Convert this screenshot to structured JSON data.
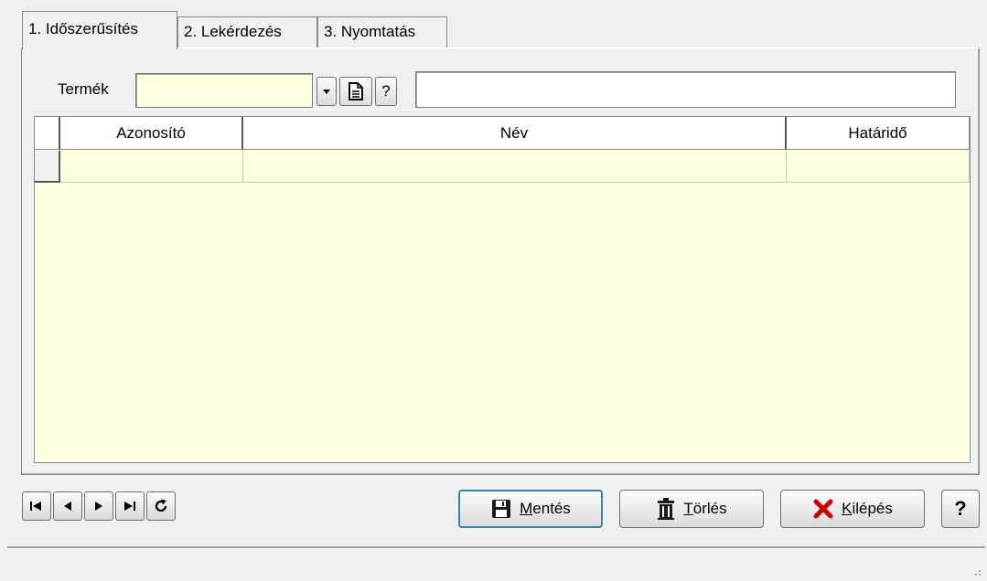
{
  "tabs": [
    {
      "label": "1. Időszerűsítés"
    },
    {
      "label": "2. Lekérdezés"
    },
    {
      "label": "3. Nyomtatás"
    }
  ],
  "filter": {
    "label": "Termék",
    "value": "",
    "description": ""
  },
  "grid": {
    "columns": [
      "Azonosító",
      "Név",
      "Határidő"
    ],
    "rows": [
      [
        "",
        "",
        ""
      ]
    ]
  },
  "buttons": {
    "save_u": "M",
    "save_rest": "entés",
    "delete_u": "T",
    "delete_rest": "örlés",
    "exit_u": "K",
    "exit_rest": "ilépés",
    "help": "?"
  },
  "lookup": {
    "help": "?"
  },
  "colors": {
    "grid_bg": "#ffffe1",
    "field_bg": "#ffffe1",
    "exit_icon": "#cc0000"
  }
}
